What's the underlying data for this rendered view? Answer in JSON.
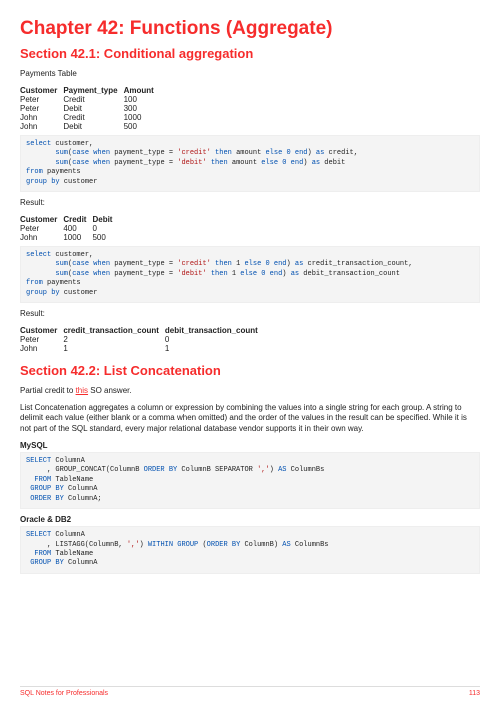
{
  "chapter_title": "Chapter 42: Functions (Aggregate)",
  "sections": {
    "s1": {
      "title": "Section 42.1: Conditional aggregation",
      "intro": "Payments Table",
      "table1": {
        "headers": [
          "Customer",
          "Payment_type",
          "Amount"
        ],
        "rows": [
          [
            "Peter",
            "Credit",
            "100"
          ],
          [
            "Peter",
            "Debit",
            "300"
          ],
          [
            "John",
            "Credit",
            "1000"
          ],
          [
            "John",
            "Debit",
            "500"
          ]
        ]
      },
      "result_label": "Result:",
      "table2": {
        "headers": [
          "Customer",
          "Credit",
          "Debit"
        ],
        "rows": [
          [
            "Peter",
            "400",
            "0"
          ],
          [
            "John",
            "1000",
            "500"
          ]
        ]
      },
      "table3": {
        "headers": [
          "Customer",
          "credit_transaction_count",
          "debit_transaction_count"
        ],
        "rows": [
          [
            "Peter",
            "2",
            "0"
          ],
          [
            "John",
            "1",
            "1"
          ]
        ]
      }
    },
    "s2": {
      "title": "Section 42.2: List Concatenation",
      "credit_pre": "Partial credit to ",
      "credit_link": "this",
      "credit_post": " SO answer.",
      "desc": "List Concatenation aggregates a column or expression by combining the values into a single string for each group. A string to delimit each value (either blank or a comma when omitted) and the order of the values in the result can be specified. While it is not part of the SQL standard, every major relational database vendor supports it in their own way.",
      "mysql_label": "MySQL",
      "oracle_label": "Oracle & DB2"
    }
  },
  "code": {
    "c1": {
      "l1a": "select",
      "l1b": " customer,",
      "l2a": "       ",
      "l2b": "sum",
      "l2c": "(",
      "l2d": "case when",
      "l2e": " payment_type = ",
      "l2f": "'credit'",
      "l2g": " then",
      "l2h": " amount ",
      "l2i": "else 0 end",
      "l2j": ") ",
      "l2k": "as",
      "l2l": " credit,",
      "l3a": "       ",
      "l3b": "sum",
      "l3c": "(",
      "l3d": "case when",
      "l3e": " payment_type = ",
      "l3f": "'debit'",
      "l3g": " then",
      "l3h": " amount ",
      "l3i": "else 0 end",
      "l3j": ") ",
      "l3k": "as",
      "l3l": " debit",
      "l4a": "from",
      "l4b": " payments",
      "l5a": "group by",
      "l5b": " customer"
    },
    "c2": {
      "l1a": "select",
      "l1b": " customer,",
      "l2a": "       ",
      "l2b": "sum",
      "l2c": "(",
      "l2d": "case when",
      "l2e": " payment_type = ",
      "l2f": "'credit'",
      "l2g": " then",
      "l2h": " 1 ",
      "l2i": "else 0 end",
      "l2j": ") ",
      "l2k": "as",
      "l2l": " credit_transaction_count,",
      "l3a": "       ",
      "l3b": "sum",
      "l3c": "(",
      "l3d": "case when",
      "l3e": " payment_type = ",
      "l3f": "'debit'",
      "l3g": " then",
      "l3h": " 1 ",
      "l3i": "else 0 end",
      "l3j": ") ",
      "l3k": "as",
      "l3l": " debit_transaction_count",
      "l4a": "from",
      "l4b": " payments",
      "l5a": "group by",
      "l5b": " customer"
    },
    "c3": {
      "l1a": "SELECT",
      "l1b": " ColumnA",
      "l2a": "     , GROUP_CONCAT(ColumnB ",
      "l2b": "ORDER BY",
      "l2c": " ColumnB SEPARATOR ",
      "l2d": "','",
      "l2e": ") ",
      "l2f": "AS",
      "l2g": " ColumnBs",
      "l3a": "  FROM",
      "l3b": " TableName",
      "l4a": " GROUP BY",
      "l4b": " ColumnA",
      "l5a": " ORDER BY",
      "l5b": " ColumnA;"
    },
    "c4": {
      "l1a": "SELECT",
      "l1b": " ColumnA",
      "l2a": "     , LISTAGG(ColumnB, ",
      "l2b": "','",
      "l2c": ") ",
      "l2d": "WITHIN GROUP",
      "l2e": " (",
      "l2f": "ORDER BY",
      "l2g": " ColumnB) ",
      "l2h": "AS",
      "l2i": " ColumnBs",
      "l3a": "  FROM",
      "l3b": " TableName",
      "l4a": " GROUP BY",
      "l4b": " ColumnA"
    }
  },
  "footer": {
    "left": "SQL Notes for Professionals",
    "right": "113"
  }
}
